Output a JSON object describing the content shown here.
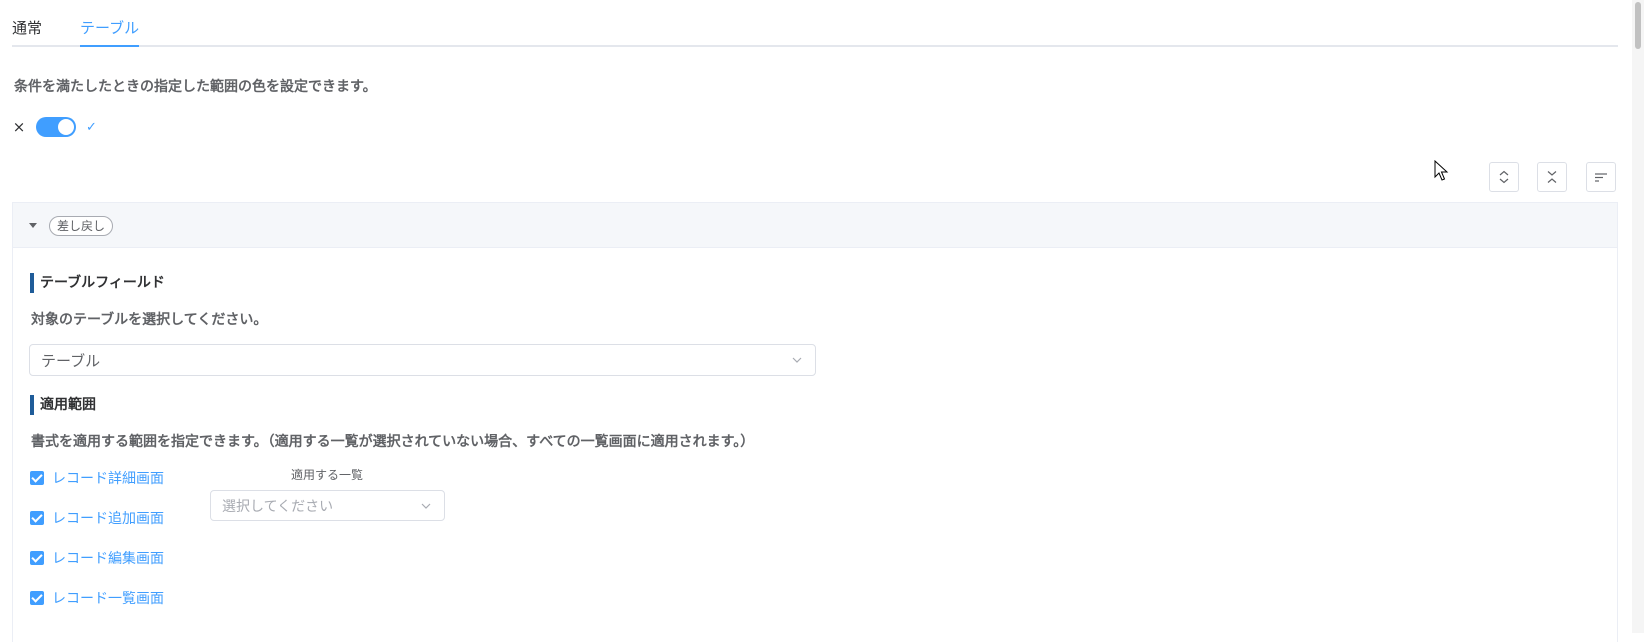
{
  "tabs": [
    {
      "label": "通常"
    },
    {
      "label": "テーブル"
    }
  ],
  "description": "条件を満たしたときの指定した範囲の色を設定できます。",
  "toggle": {
    "off_icon": "×",
    "on_icon": "✓",
    "enabled": true
  },
  "toolbar": {
    "expand_all": "expand-all-icon",
    "collapse_all": "collapse-all-icon",
    "sort": "sort-icon"
  },
  "rule": {
    "chip": "差し戻し",
    "table_field": {
      "title": "テーブルフィールド",
      "desc": "対象のテーブルを選択してください。",
      "selected": "テーブル"
    },
    "scope": {
      "title": "適用範囲",
      "desc": "書式を適用する範囲を指定できます。（適用する一覧が選択されていない場合、すべての一覧画面に適用されます。）",
      "list_label": "適用する一覧",
      "list_placeholder": "選択してください",
      "options": [
        {
          "label": "レコード詳細画面",
          "checked": true
        },
        {
          "label": "レコード追加画面",
          "checked": true
        },
        {
          "label": "レコード編集画面",
          "checked": true
        },
        {
          "label": "レコード一覧画面",
          "checked": true
        }
      ]
    }
  },
  "colors": {
    "accent": "#409eff",
    "section_bar": "#1f5c99"
  }
}
